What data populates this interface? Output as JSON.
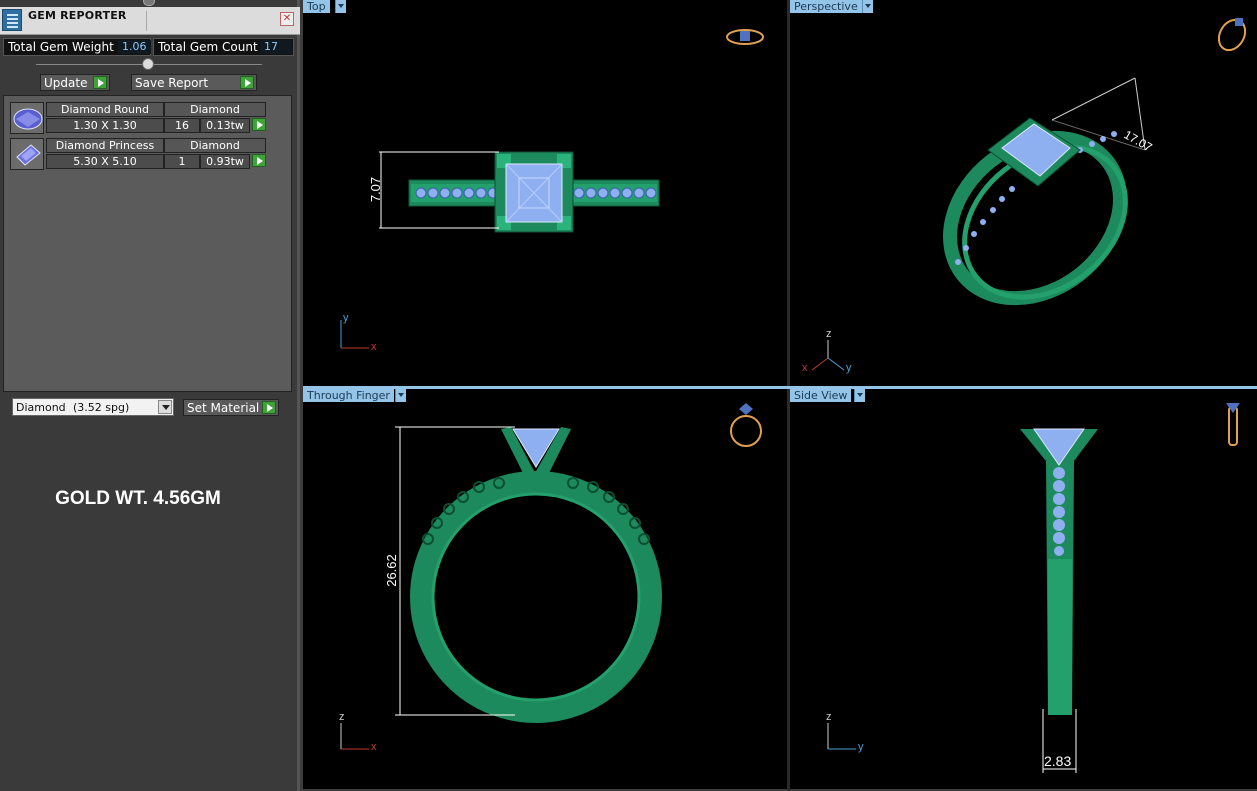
{
  "panel": {
    "title": "GEM REPORTER",
    "close_glyph": "✕",
    "stats": {
      "weight_label": "Total Gem Weight",
      "weight_value": "1.06",
      "count_label": "Total Gem Count",
      "count_value": "17"
    },
    "update_label": "Update",
    "save_report_label": "Save Report",
    "gems": [
      {
        "name": "Diamond Round",
        "type": "Diamond",
        "size": "1.30 X 1.30",
        "count": "16",
        "weight": "0.13tw",
        "icon": "round-gem-icon"
      },
      {
        "name": "Diamond Princess",
        "type": "Diamond",
        "size": "5.30 X 5.10",
        "count": "1",
        "weight": "0.93tw",
        "icon": "princess-gem-icon"
      }
    ],
    "material": {
      "name": "Diamond",
      "spg": "(3.52 spg)"
    },
    "set_material_label": "Set Material",
    "gold_weight": "GOLD WT. 4.56GM"
  },
  "viewports": {
    "top": {
      "label": "Top",
      "dimension": "7.07",
      "axes": [
        "y",
        "x"
      ]
    },
    "perspective": {
      "label": "Perspective",
      "dimension": "17.07",
      "axes": [
        "z",
        "x",
        "y"
      ]
    },
    "finger": {
      "label": "Through Finger",
      "dimension": "26.62",
      "axes": [
        "z",
        "x"
      ]
    },
    "side": {
      "label": "Side View",
      "dimension": "2.83",
      "axes": [
        "z",
        "y"
      ]
    }
  },
  "colors": {
    "metal": "#1d8a5e",
    "gem": "#8fb0f0",
    "tab": "#94c5e8",
    "axis_x": "#c03a2b",
    "axis_y": "#4a9fd8",
    "axis_z": "#cccccc"
  }
}
